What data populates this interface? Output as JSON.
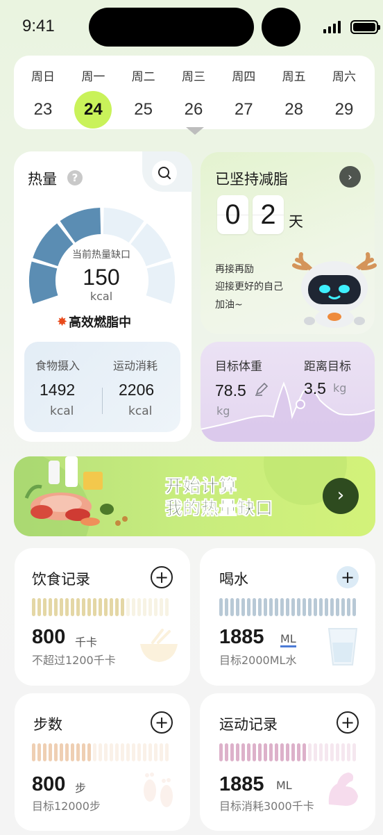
{
  "status_bar": {
    "time": "9:41"
  },
  "week": {
    "days": [
      {
        "name": "周日",
        "date": "23"
      },
      {
        "name": "周一",
        "date": "24"
      },
      {
        "name": "周二",
        "date": "25"
      },
      {
        "name": "周三",
        "date": "26"
      },
      {
        "name": "周四",
        "date": "27"
      },
      {
        "name": "周五",
        "date": "28"
      },
      {
        "name": "周六",
        "date": "29"
      }
    ],
    "selected_date": "24"
  },
  "heat": {
    "title": "热量",
    "help_icon": "?",
    "gauge_label": "当前热量缺口",
    "gauge_value": "150",
    "gauge_unit": "kcal",
    "gauge_filled_segments": 3,
    "gauge_total_segments": 6,
    "status": "高效燃脂中",
    "food_label": "食物摄入",
    "food_value": "1492",
    "food_unit": "kcal",
    "exercise_label": "运动消耗",
    "exercise_value": "2206",
    "exercise_unit": "kcal"
  },
  "persist": {
    "title": "已坚持减脂",
    "digits": [
      "0",
      "2"
    ],
    "unit": "天",
    "cheer_lines": [
      "再接再励",
      "迎接更好的自己",
      "加油~"
    ]
  },
  "weight": {
    "target_label": "目标体重",
    "target_value": "78.5",
    "target_unit": "kg",
    "distance_label": "距离目标",
    "distance_value": "3.5",
    "distance_unit": "kg"
  },
  "banner": {
    "line1": "开始计算",
    "line2": "我的热量缺口",
    "button_icon": "›"
  },
  "tiles": {
    "diet": {
      "title": "饮食记录",
      "value": "800",
      "unit": "千卡",
      "subtitle": "不超过1200千卡",
      "progress": 0.67,
      "color": "#e4d7a5"
    },
    "water": {
      "title": "喝水",
      "value": "1885",
      "unit": "ML",
      "subtitle": "目标2000ML水",
      "progress": 1.0,
      "color": "#b8c9d6"
    },
    "steps": {
      "title": "步数",
      "value": "800",
      "unit": "步",
      "subtitle": "目标12000步",
      "progress": 0.42,
      "color": "#efcfb3"
    },
    "exercise": {
      "title": "运动记录",
      "value": "1885",
      "unit": "ML",
      "subtitle": "目标消耗3000千卡",
      "progress": 0.62,
      "color": "#ddb1ca"
    }
  },
  "colors": {
    "accent_green": "#c9f25a",
    "gauge_dark": "#5b8db3",
    "gauge_light": "#e8f1f8",
    "banner_button": "#2e4b1f"
  }
}
